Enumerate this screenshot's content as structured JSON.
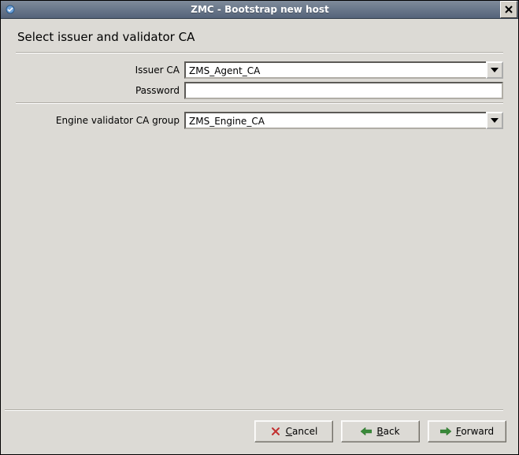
{
  "window": {
    "title": "ZMC - Bootstrap new host"
  },
  "heading": "Select issuer and validator CA",
  "fields": {
    "issuer_ca": {
      "label": "Issuer CA",
      "value": "ZMS_Agent_CA"
    },
    "password": {
      "label": "Password",
      "value": ""
    },
    "engine_validator": {
      "label": "Engine validator CA group",
      "value": "ZMS_Engine_CA"
    }
  },
  "buttons": {
    "cancel": "Cancel",
    "back": "Back",
    "forward": "Forward"
  }
}
